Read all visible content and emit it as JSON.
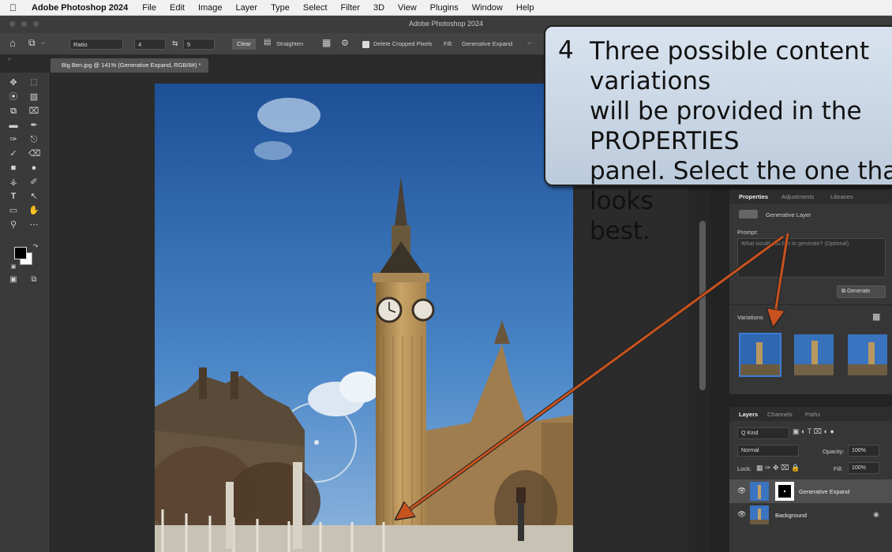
{
  "menubar": {
    "app_name": "Adobe Photoshop 2024",
    "items": [
      "File",
      "Edit",
      "Image",
      "Layer",
      "Type",
      "Select",
      "Filter",
      "3D",
      "View",
      "Plugins",
      "Window",
      "Help"
    ]
  },
  "window": {
    "title": "Adobe Photoshop 2024"
  },
  "options_bar": {
    "ratio_label": "Ratio",
    "width_value": "4",
    "height_value": "5",
    "clear_label": "Clear",
    "straighten_label": "Straighten",
    "delete_cropped_label": "Delete Cropped Pixels",
    "fill_label": "Fill:",
    "fill_value": "Generative Expand"
  },
  "document_tab": {
    "title": "Big Ben.jpg @ 141% (Generative Expand, RGB/8#) *"
  },
  "callout": {
    "number": "4",
    "text": "Three possible content variations\nwill be provided in the PROPERTIES\npanel.  Select the one that looks\nbest."
  },
  "properties_panel": {
    "tabs": [
      "Properties",
      "Adjustments",
      "Libraries"
    ],
    "layer_type": "Generative Layer",
    "prompt_label": "Prompt:",
    "prompt_placeholder": "What would you like to generate? (Optional)",
    "generate_label": "Generate",
    "variations_label": "Variations",
    "selected_variation": 1,
    "variation_count": 3
  },
  "layers_panel": {
    "tabs": [
      "Layers",
      "Channels",
      "Paths"
    ],
    "kind_filter": "Q Kind",
    "blend_mode": "Normal",
    "opacity_label": "Opacity:",
    "opacity_value": "100%",
    "lock_label": "Lock:",
    "fill_label": "Fill:",
    "fill_value": "100%",
    "layers": [
      {
        "name": "Generative Expand",
        "selected": true
      },
      {
        "name": "Background",
        "selected": false
      }
    ]
  },
  "colors": {
    "accent": "#3e7cd4",
    "arrow": "#c8521e",
    "callout_fill": "#cdd8e6"
  }
}
